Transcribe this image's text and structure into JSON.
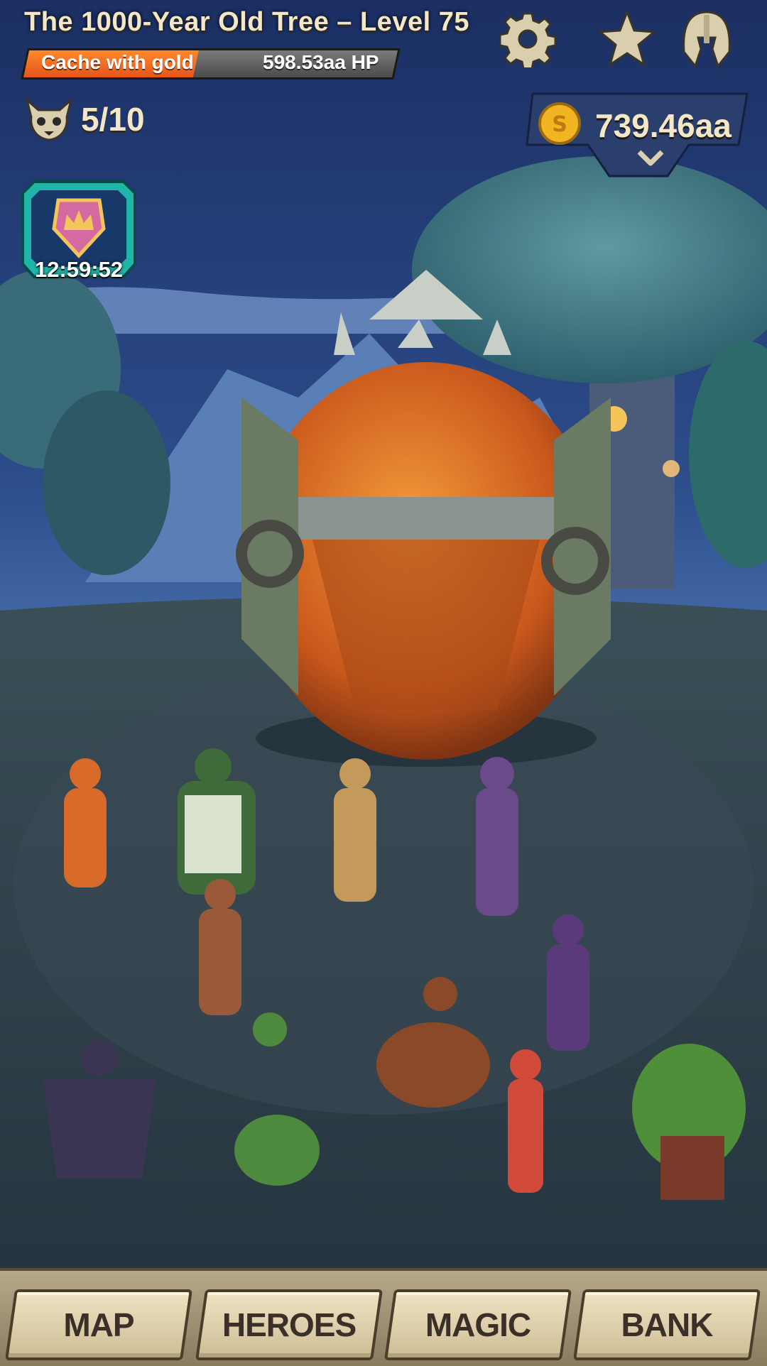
{
  "boss": {
    "title": "The 1000-Year Old Tree – Level 75",
    "reward_label": "Cache with gold",
    "hp": "598.53aa HP",
    "hp_fraction": 0.46
  },
  "header_icons": [
    "gear-icon",
    "star-icon",
    "helmet-icon"
  ],
  "wave": {
    "icon": "demon-skull-icon",
    "progress": "5/10"
  },
  "gold": {
    "icon": "gold-coin-icon",
    "amount": "739.46aa"
  },
  "event": {
    "icon": "crown-shield-icon",
    "timer": "12:59:52"
  },
  "nav": {
    "items": [
      "MAP",
      "HEROES",
      "MAGIC",
      "BANK"
    ]
  },
  "colors": {
    "hp_fill": "#e4551d",
    "text_cream": "#f3e7c7",
    "event_frame": "#1fb5a8"
  }
}
